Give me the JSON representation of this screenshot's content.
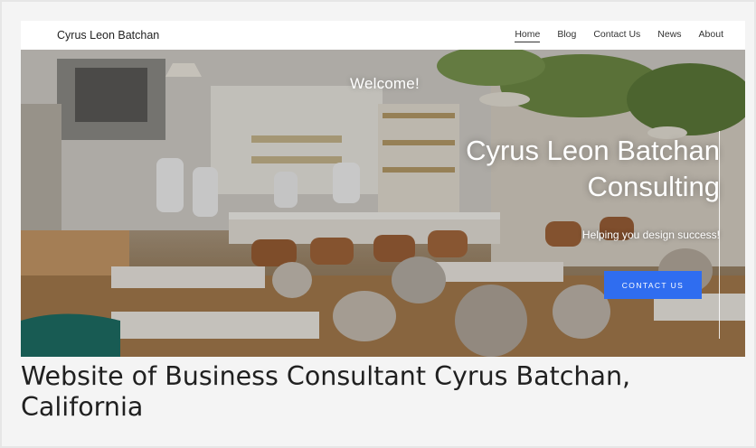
{
  "site": {
    "brand": "Cyrus Leon Batchan",
    "nav": [
      {
        "label": "Home",
        "active": true
      },
      {
        "label": "Blog"
      },
      {
        "label": "Contact Us"
      },
      {
        "label": "News"
      },
      {
        "label": "About"
      }
    ]
  },
  "hero": {
    "welcome": "Welcome!",
    "title_line1": "Cyrus Leon Batchan",
    "title_line2": "Consulting",
    "tagline": "Helping you design success!",
    "cta_label": "CONTACT US",
    "cta_color": "#2f6df0",
    "image_subject": "restaurant-interior-photo"
  },
  "caption": "Website of Business Consultant Cyrus Batchan, California"
}
